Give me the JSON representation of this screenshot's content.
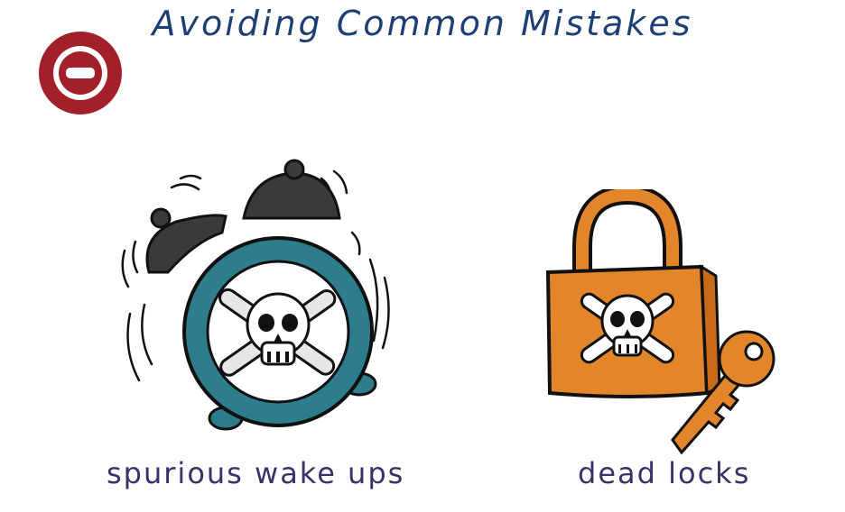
{
  "title": "Avoiding Common Mistakes",
  "icons": {
    "stop": "stop-icon",
    "clock": "alarm-clock-skull-icon",
    "lock": "padlock-skull-icon",
    "key": "key-icon"
  },
  "colors": {
    "title": "#1d3f73",
    "caption": "#3e2f68",
    "stop": "#a3202b",
    "clock_ring": "#2e7d8c",
    "lock_body": "#e3862b"
  },
  "captions": {
    "left": "spurious wake ups",
    "right": "dead locks"
  }
}
